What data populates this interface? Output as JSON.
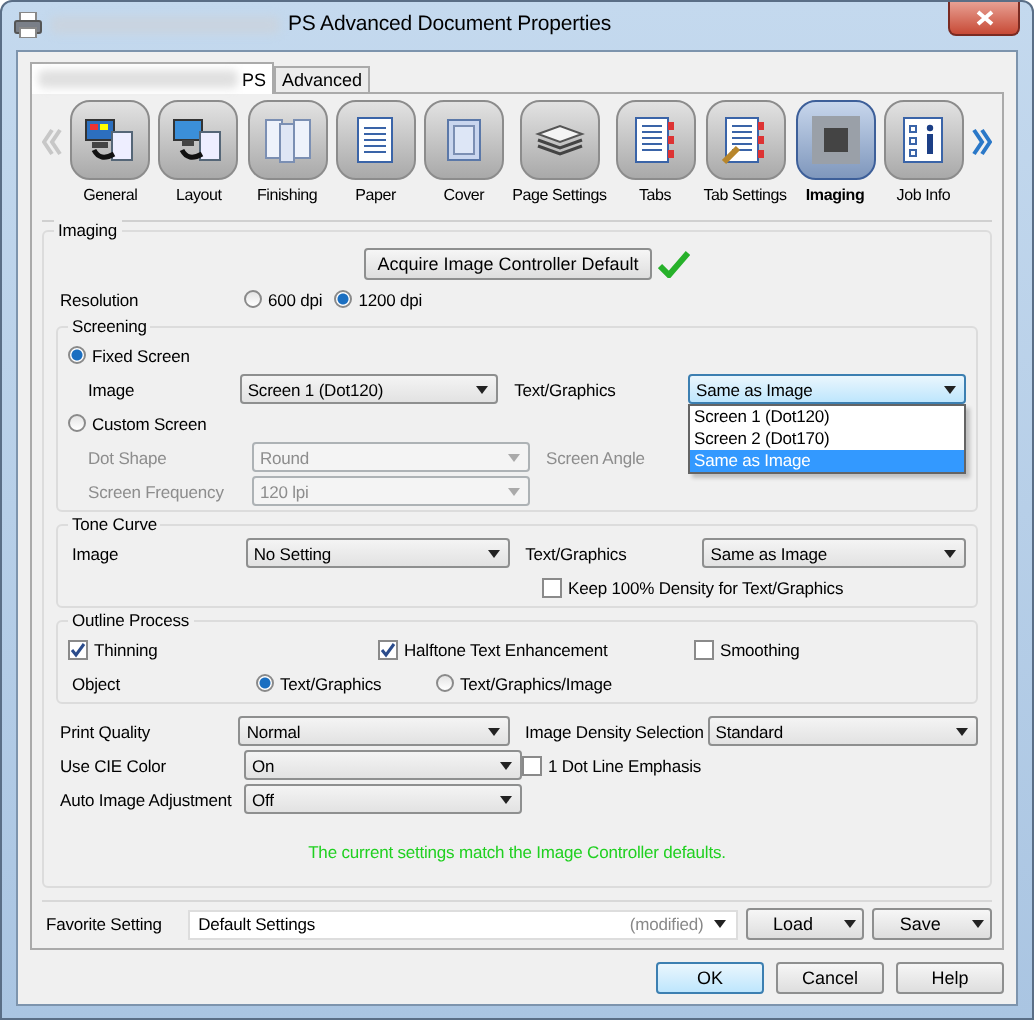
{
  "window": {
    "title": "PS Advanced Document Properties"
  },
  "tabs": [
    {
      "label": "PS",
      "selected": true
    },
    {
      "label": "Advanced",
      "selected": false
    }
  ],
  "toolbar": {
    "items": [
      {
        "label": "General",
        "selected": false
      },
      {
        "label": "Layout",
        "selected": false
      },
      {
        "label": "Finishing",
        "selected": false
      },
      {
        "label": "Paper",
        "selected": false
      },
      {
        "label": "Cover",
        "selected": false
      },
      {
        "label": "Page Settings",
        "selected": false
      },
      {
        "label": "Tabs",
        "selected": false
      },
      {
        "label": "Tab Settings",
        "selected": false
      },
      {
        "label": "Imaging",
        "selected": true
      },
      {
        "label": "Job Info",
        "selected": false
      }
    ]
  },
  "imaging": {
    "title": "Imaging",
    "acquire_button": "Acquire Image Controller Default",
    "resolution": {
      "label": "Resolution",
      "options": [
        {
          "label": "600 dpi",
          "selected": false
        },
        {
          "label": "1200 dpi",
          "selected": true
        }
      ]
    },
    "screening": {
      "title": "Screening",
      "fixed": {
        "label": "Fixed Screen",
        "selected": true
      },
      "image": {
        "label": "Image",
        "value": "Screen 1 (Dot120)"
      },
      "text_graphics": {
        "label": "Text/Graphics",
        "value": "Same as Image",
        "expanded": true,
        "options": [
          {
            "label": "Screen 1 (Dot120)",
            "selected": false
          },
          {
            "label": "Screen 2 (Dot170)",
            "selected": false
          },
          {
            "label": "Same as Image",
            "selected": true
          }
        ]
      },
      "custom": {
        "label": "Custom Screen",
        "selected": false
      },
      "dot_shape": {
        "label": "Dot Shape",
        "value": "Round",
        "disabled": true
      },
      "screen_angle": {
        "label": "Screen Angle",
        "disabled": true
      },
      "screen_frequency": {
        "label": "Screen Frequency",
        "value": "120 lpi",
        "disabled": true
      }
    },
    "tone_curve": {
      "title": "Tone Curve",
      "image": {
        "label": "Image",
        "value": "No Setting"
      },
      "text_graphics": {
        "label": "Text/Graphics",
        "value": "Same as Image"
      },
      "keep_density": {
        "label": "Keep 100% Density for Text/Graphics",
        "checked": false
      }
    },
    "outline_process": {
      "title": "Outline Process",
      "checks": [
        {
          "label": "Thinning",
          "checked": true
        },
        {
          "label": "Halftone Text Enhancement",
          "checked": true
        },
        {
          "label": "Smoothing",
          "checked": false
        }
      ],
      "object": {
        "label": "Object",
        "options": [
          {
            "label": "Text/Graphics",
            "selected": true
          },
          {
            "label": "Text/Graphics/Image",
            "selected": false
          }
        ]
      }
    },
    "print_quality": {
      "label": "Print Quality",
      "value": "Normal"
    },
    "image_density": {
      "label": "Image Density Selection",
      "value": "Standard"
    },
    "use_cie_color": {
      "label": "Use CIE Color",
      "value": "On"
    },
    "dot_line_emphasis": {
      "label": "1 Dot Line Emphasis",
      "checked": false
    },
    "auto_adjustment": {
      "label": "Auto Image Adjustment",
      "value": "Off"
    },
    "status_message": "The current settings match the Image Controller defaults."
  },
  "favorite": {
    "label": "Favorite Setting",
    "value": "Default Settings",
    "note": "(modified)",
    "load": "Load",
    "save": "Save"
  },
  "buttons": [
    {
      "label": "OK",
      "default": true
    },
    {
      "label": "Cancel",
      "default": false
    },
    {
      "label": "Help",
      "default": false
    }
  ]
}
